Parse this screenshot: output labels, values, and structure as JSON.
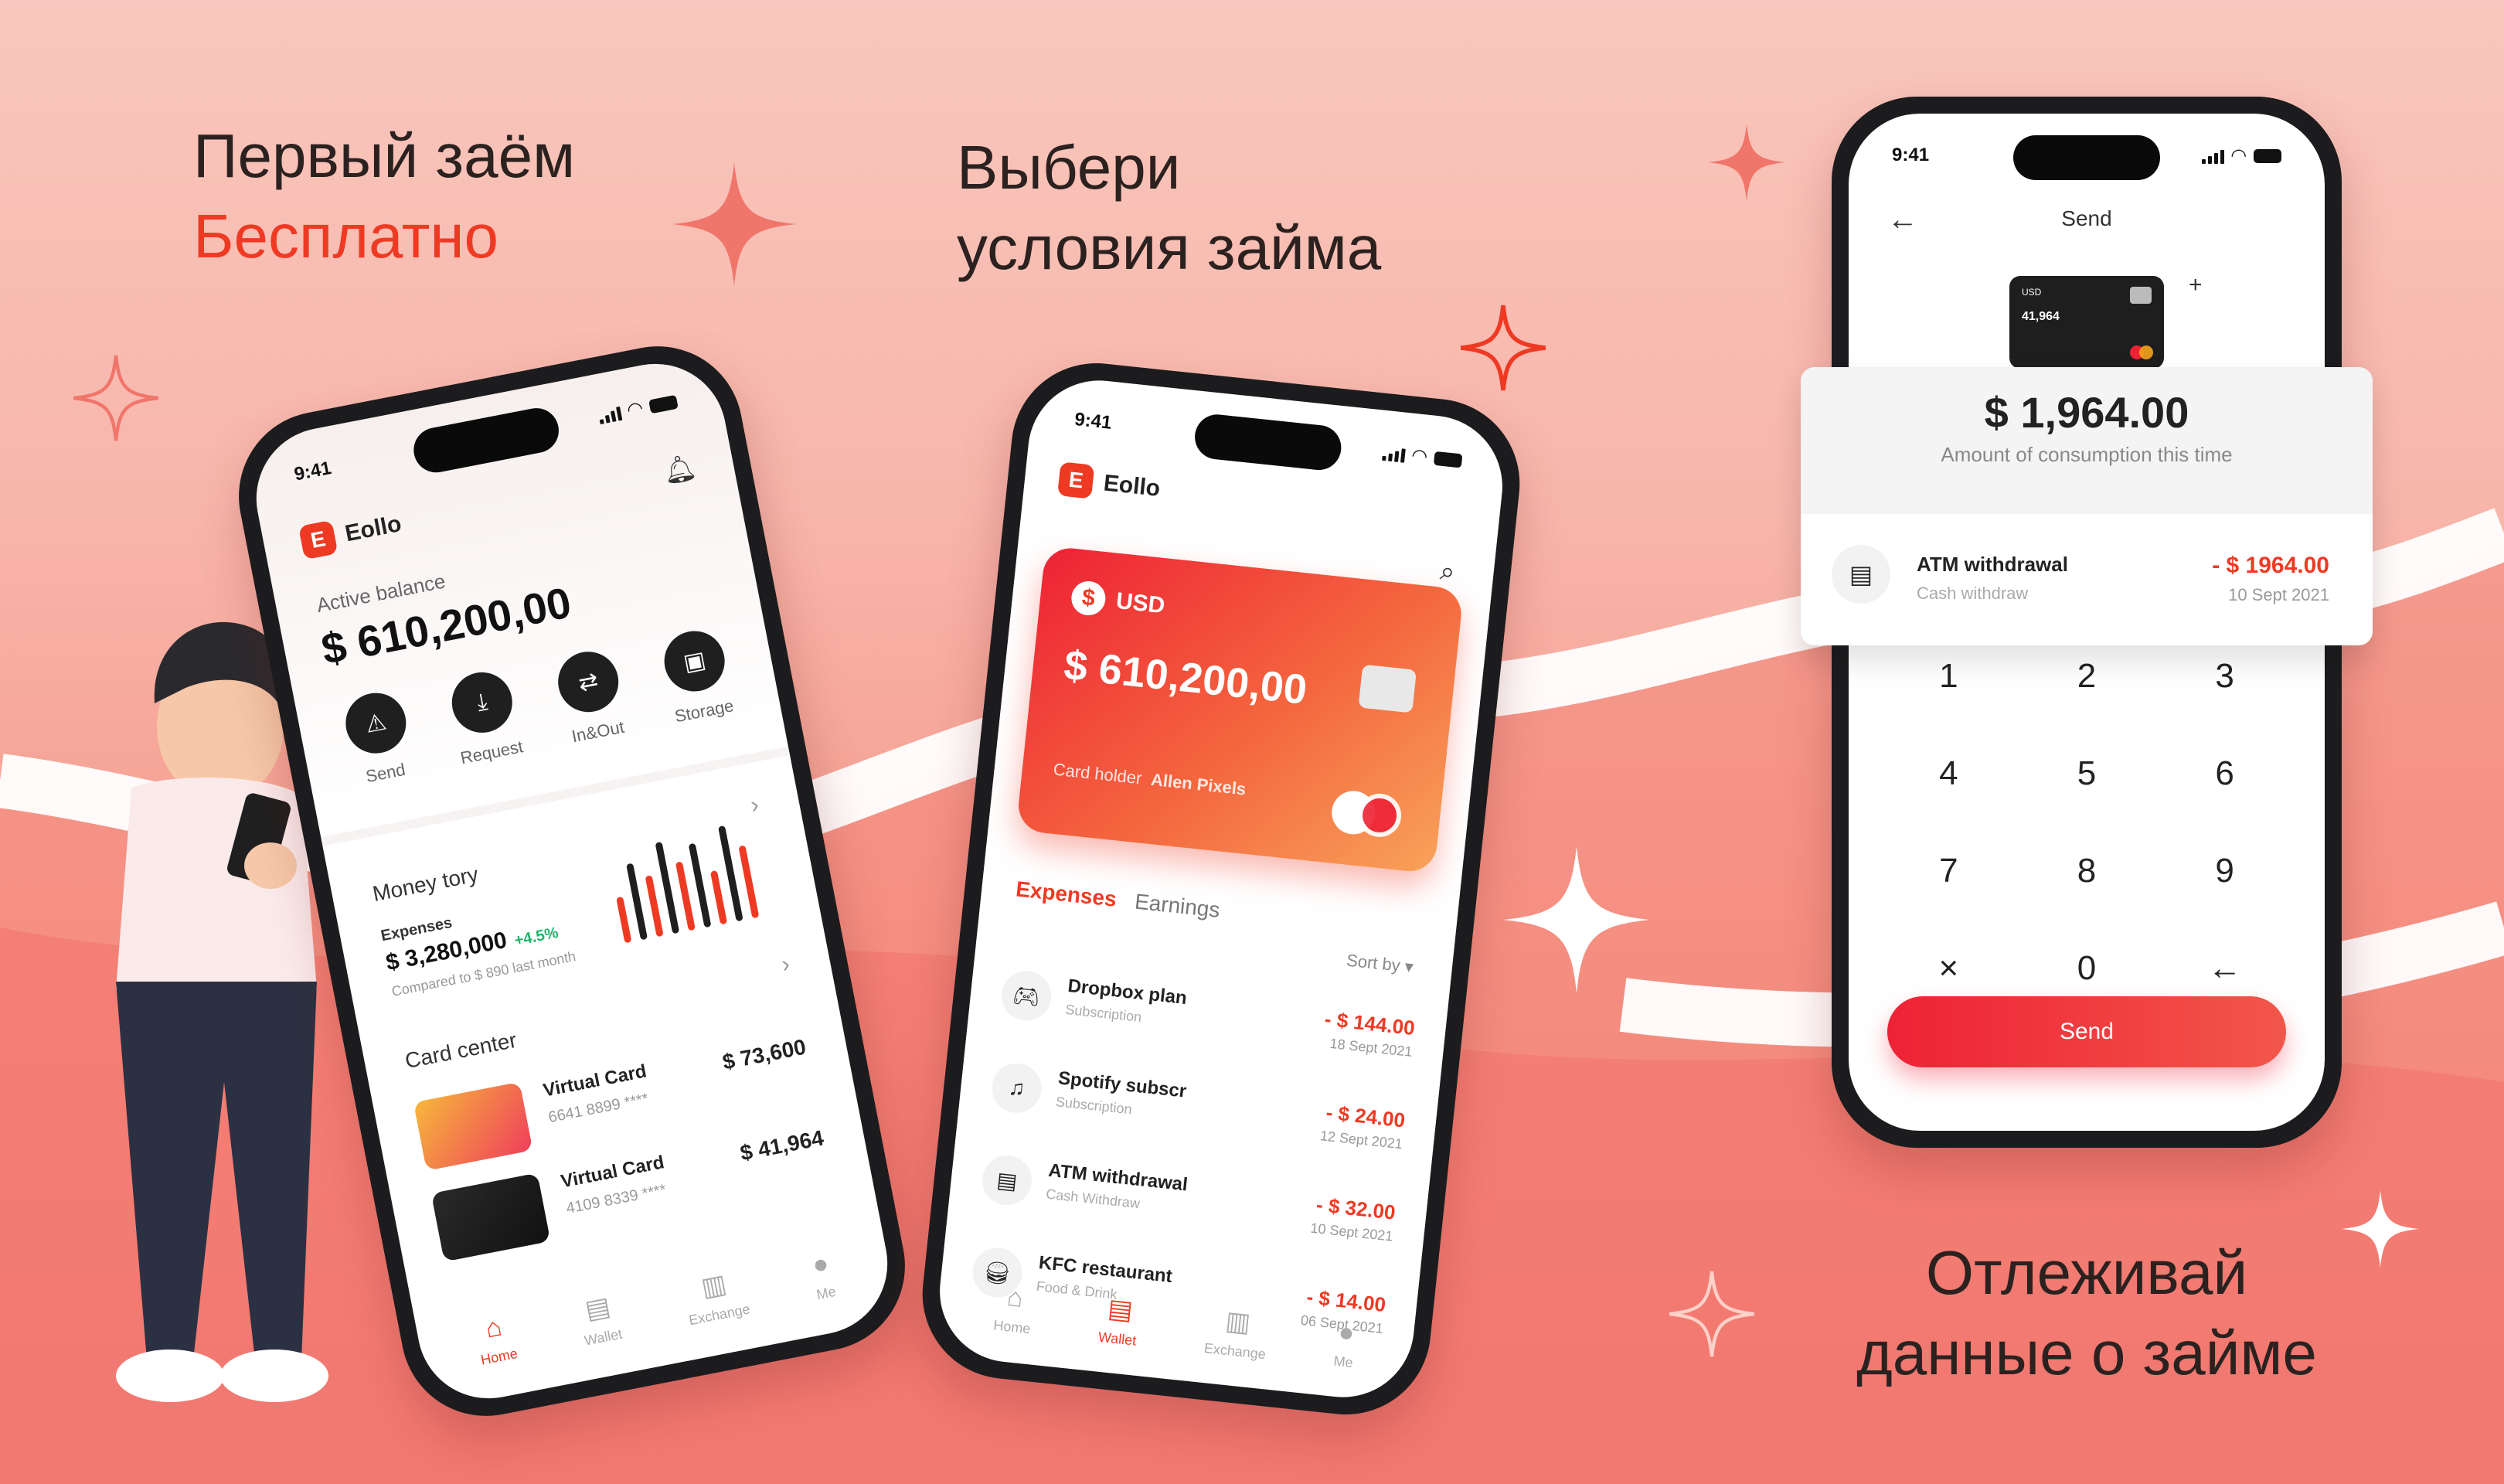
{
  "headlines": {
    "left_line1": "Первый заём",
    "left_line2": "Бесплатно",
    "mid_line1": "Выбери",
    "mid_line2": "условия займа",
    "right_line1": "Отлеживай",
    "right_line2": "данные о займе"
  },
  "colors": {
    "accent": "#ee3a23",
    "positive": "#1fb46b"
  },
  "phone_home": {
    "time": "9:41",
    "brand": "Eollo",
    "brand_mark": "E",
    "balance_label": "Active balance",
    "balance_value": "$ 610,200,00",
    "actions": [
      {
        "label": "Send",
        "icon": "warning-icon"
      },
      {
        "label": "Request",
        "icon": "download-icon"
      },
      {
        "label": "In&Out",
        "icon": "swap-icon"
      },
      {
        "label": "Storage",
        "icon": "storage-icon"
      }
    ],
    "money_history_title": "Money tory",
    "expenses_label": "Expenses",
    "expenses_value": "$ 3,280,000",
    "expenses_change": "+4.5%",
    "expenses_compare": "Compared to $ 890 last month",
    "card_center_title": "Card center",
    "cards": [
      {
        "name": "Virtual Card",
        "number": "6641 8899 ****",
        "amount": "$ 73,600"
      },
      {
        "name": "Virtual Card",
        "number": "4109 8339 ****",
        "amount": "$ 41,964"
      }
    ],
    "tabs": [
      "Home",
      "Wallet",
      "Exchange",
      "Me"
    ]
  },
  "phone_wallet": {
    "time": "9:41",
    "brand": "Eollo",
    "card_currency": "USD",
    "card_amount": "$ 610,200,00",
    "card_holder_label": "Card holder",
    "card_holder_name": "Allen Pixels",
    "tab_expenses": "Expenses",
    "tab_earnings": "Earnings",
    "sort_by": "Sort by",
    "transactions": [
      {
        "name": "Dropbox plan",
        "sub": "Subscription",
        "amount": "- $ 144.00",
        "date": "18 Sept 2021",
        "icon": "gamepad-icon"
      },
      {
        "name": "Spotify subscr",
        "sub": "Subscription",
        "amount": "- $ 24.00",
        "date": "12 Sept 2021",
        "icon": "music-icon"
      },
      {
        "name": "ATM withdrawal",
        "sub": "Cash Withdraw",
        "amount": "- $ 32.00",
        "date": "10 Sept 2021",
        "icon": "wallet-icon"
      },
      {
        "name": "KFC restaurant",
        "sub": "Food & Drink",
        "amount": "- $ 14.00",
        "date": "06 Sept 2021",
        "icon": "food-icon"
      }
    ],
    "tabs": [
      "Home",
      "Wallet",
      "Exchange",
      "Me"
    ]
  },
  "phone_send": {
    "time": "9:41",
    "title": "Send",
    "card_currency": "USD",
    "card_amount": "41,964",
    "amount": "$ 1,964.00",
    "amount_caption": "Amount of consumption this time",
    "tx_name": "ATM withdrawal",
    "tx_type": "Cash withdraw",
    "tx_amount": "- $ 1964.00",
    "tx_date": "10 Sept 2021",
    "keys": [
      "1",
      "2",
      "3",
      "4",
      "5",
      "6",
      "7",
      "8",
      "9",
      "×",
      "0",
      "←"
    ],
    "send_label": "Send"
  }
}
